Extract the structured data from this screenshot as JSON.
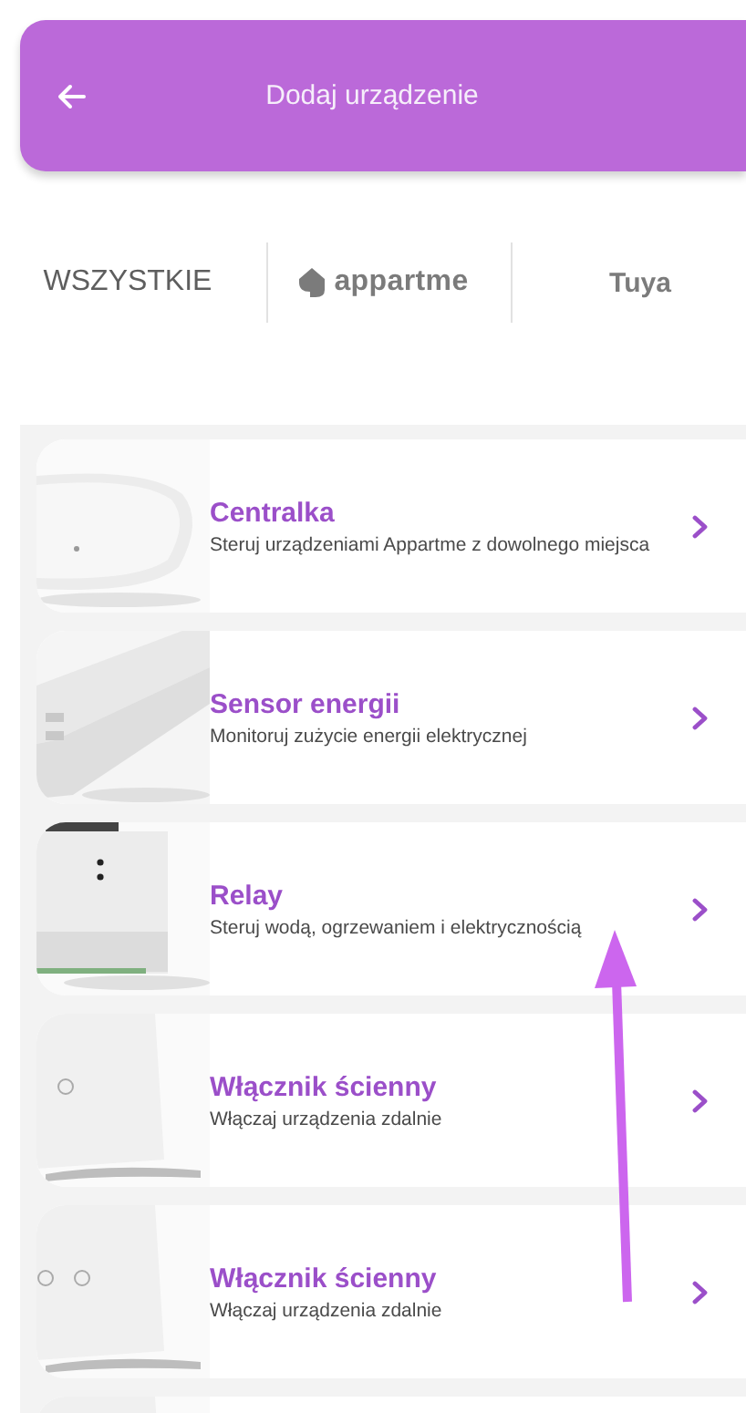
{
  "header": {
    "title": "Dodaj urządzenie"
  },
  "tabs": [
    {
      "kind": "text",
      "label": "WSZYSTKIE"
    },
    {
      "kind": "logo",
      "label": "appartme"
    },
    {
      "kind": "bold",
      "label": "Tuya"
    }
  ],
  "devices": [
    {
      "kind": "device",
      "title": "Centralka",
      "description": "Steruj urządzeniami Appartme z dowolnego miejsca"
    },
    {
      "kind": "device",
      "title": "Sensor energii",
      "description": "Monitoruj zużycie energii elektrycznej"
    },
    {
      "kind": "device",
      "title": "Relay",
      "description": "Steruj wodą, ogrzewaniem i elektrycznością"
    },
    {
      "kind": "device",
      "title": "Włącznik ścienny",
      "description": "Włączaj urządzenia zdalnie"
    },
    {
      "kind": "device",
      "title": "Włącznik ścienny",
      "description": "Włączaj urządzenia zdalnie"
    },
    {
      "kind": "partial"
    }
  ],
  "annotation": {
    "kind": "up-arrow"
  }
}
